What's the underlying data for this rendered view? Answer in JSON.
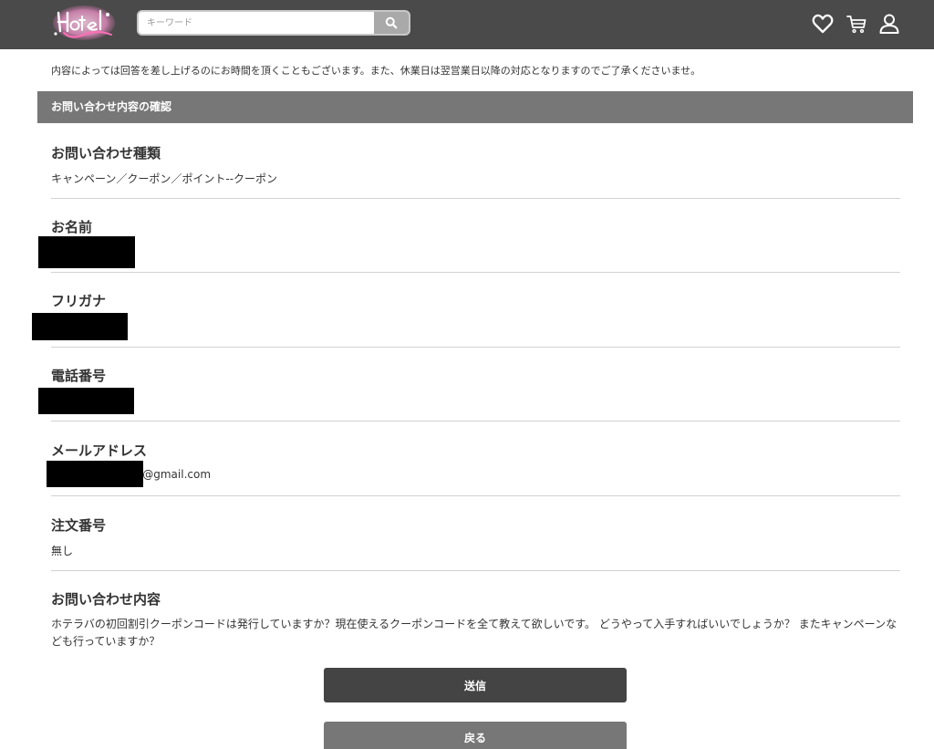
{
  "header": {
    "logo_text": "Hotel Lovers",
    "search_placeholder": "キーワード",
    "icons": [
      "heart-icon",
      "cart-icon",
      "user-icon"
    ]
  },
  "notice": "内容によっては回答を差し上げるのにお時間を頂くこともございます。また、休業日は翌営業日以降の対応となりますのでご了承くださいませ。",
  "section_title": "お問い合わせ内容の確認",
  "fields": {
    "inquiry_type": {
      "label": "お問い合わせ種類",
      "value": "キャンペーン／クーポン／ポイント--クーポン"
    },
    "name": {
      "label": "お名前",
      "value": ""
    },
    "furigana": {
      "label": "フリガナ",
      "value": ""
    },
    "phone": {
      "label": "電話番号",
      "value": ""
    },
    "email": {
      "label": "メールアドレス",
      "value": "s@gmail.com"
    },
    "order_number": {
      "label": "注文番号",
      "value": "無し"
    },
    "message": {
      "label": "お問い合わせ内容",
      "value": "ホテラバの初回割引クーポンコードは発行していますか？現在使えるクーポンコードを全て教えて欲しいです。 どうやって入手すればいいでしょうか？ またキャンペーンなども行っていますか？"
    }
  },
  "buttons": {
    "submit": "送信",
    "back": "戻る"
  },
  "colors": {
    "header_bg": "#4a4a4a",
    "section_bar": "#777777",
    "submit_bg": "#444444",
    "back_bg": "#777777"
  }
}
